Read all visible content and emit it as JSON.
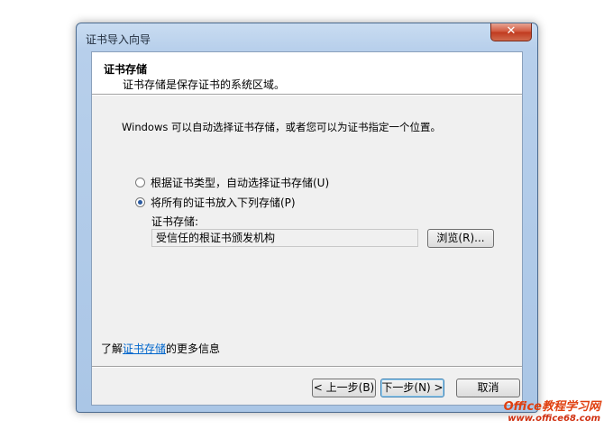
{
  "window": {
    "title": "证书导入向导",
    "close_label": "✕"
  },
  "header": {
    "title": "证书存储",
    "subtitle": "证书存储是保存证书的系统区域。"
  },
  "intro": "Windows 可以自动选择证书存储，或者您可以为证书指定一个位置。",
  "options": {
    "auto_label": "根据证书类型，自动选择证书存储(U)",
    "manual_label": "将所有的证书放入下列存储(P)"
  },
  "store": {
    "label": "证书存储:",
    "value": "受信任的根证书颁发机构",
    "browse_label": "浏览(R)..."
  },
  "learn_more": {
    "prefix": "了解",
    "link": "证书存储",
    "suffix": "的更多信息"
  },
  "footer": {
    "back_label": "< 上一步(B)",
    "next_label": "下一步(N) >",
    "cancel_label": "取消"
  },
  "watermark": {
    "line1": "Office教程学习网",
    "line2": "www.office68.com"
  }
}
